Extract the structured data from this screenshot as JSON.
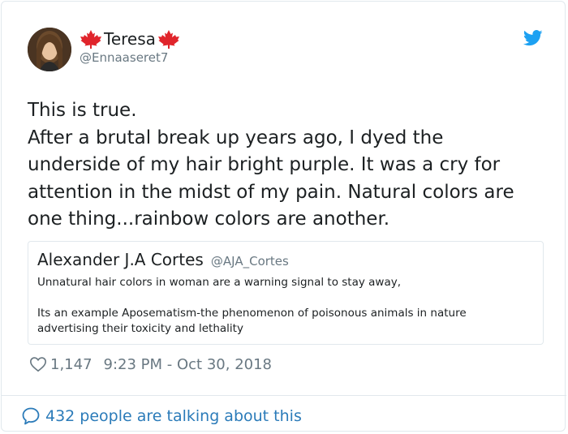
{
  "tweet": {
    "author": {
      "display_name": "Teresa",
      "handle": "@Ennaaseret7",
      "name_decoration": "maple-leaf-icon"
    },
    "text_lines": [
      "This is true.",
      "After a brutal break up years ago, I dyed the",
      "underside of my hair bright purple. It was a cry for",
      "attention in the midst of my pain. Natural colors are",
      "one thing...rainbow colors are another."
    ],
    "quoted_tweet": {
      "display_name": "Alexander J.A Cortes",
      "handle": "@AJA_Cortes",
      "lines": [
        "Unnatural hair colors in woman are a warning signal to stay away,",
        "Its an example Aposematism-the phenomenon of poisonous animals in nature",
        "advertising their toxicity and lethality"
      ]
    },
    "likes": "1,147",
    "timestamp": "9:23 PM - Oct 30, 2018",
    "conversation": "432 people are talking about this"
  },
  "colors": {
    "text": "#1c2022",
    "secondary": "#697882",
    "link": "#2b7bb9",
    "twitter_blue": "#1da1f2",
    "maple_red": "#e0242b",
    "border": "#e1e8ed"
  },
  "icons": {
    "brand": "twitter-bird-icon",
    "like": "heart-icon",
    "reply": "speech-bubble-icon"
  }
}
